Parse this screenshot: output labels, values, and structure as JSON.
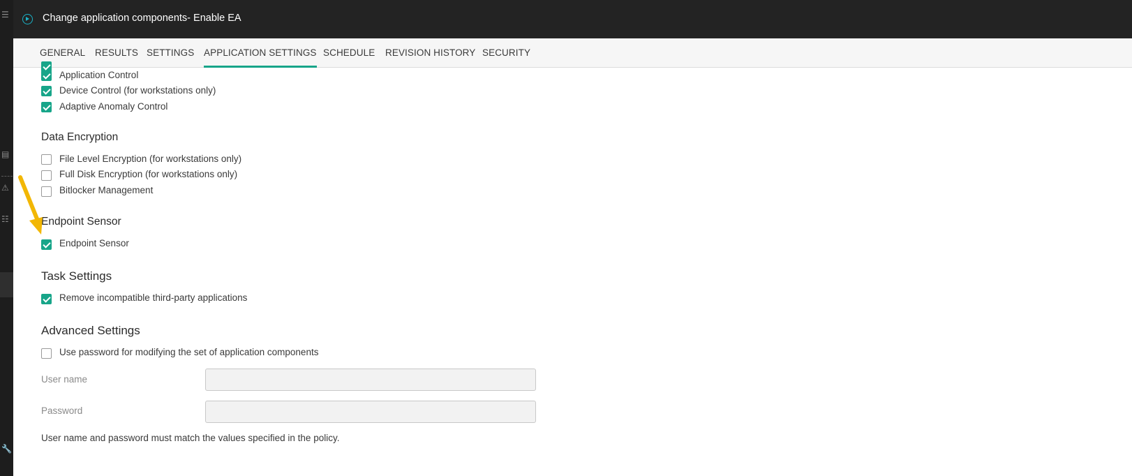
{
  "window": {
    "title": "Change application components- Enable EA"
  },
  "tabs": [
    {
      "label": "GENERAL"
    },
    {
      "label": "RESULTS"
    },
    {
      "label": "SETTINGS"
    },
    {
      "label": "APPLICATION SETTINGS",
      "active": true
    },
    {
      "label": "SCHEDULE"
    },
    {
      "label": "REVISION HISTORY"
    },
    {
      "label": "SECURITY"
    }
  ],
  "control": {
    "items": [
      {
        "label": "Application Control",
        "checked": true
      },
      {
        "label": "Device Control (for workstations only)",
        "checked": true
      },
      {
        "label": "Adaptive Anomaly Control",
        "checked": true
      }
    ]
  },
  "encryption": {
    "heading": "Data Encryption",
    "items": [
      {
        "label": "File Level Encryption (for workstations only)",
        "checked": false
      },
      {
        "label": "Full Disk Encryption (for workstations only)",
        "checked": false
      },
      {
        "label": "Bitlocker Management",
        "checked": false
      }
    ]
  },
  "sensor": {
    "heading": "Endpoint Sensor",
    "items": [
      {
        "label": "Endpoint Sensor",
        "checked": true
      }
    ]
  },
  "task": {
    "heading": "Task Settings",
    "items": [
      {
        "label": "Remove incompatible third-party applications",
        "checked": true
      }
    ]
  },
  "advanced": {
    "heading": "Advanced Settings",
    "password_option": {
      "label": "Use password for modifying the set of application components",
      "checked": false
    },
    "username_label": "User name",
    "username_value": "",
    "password_label": "Password",
    "password_value": "",
    "note": "User name and password must match the values specified in the policy."
  },
  "colors": {
    "accent": "#17a589",
    "titlebar": "#232323",
    "arrow": "#f2b705"
  }
}
